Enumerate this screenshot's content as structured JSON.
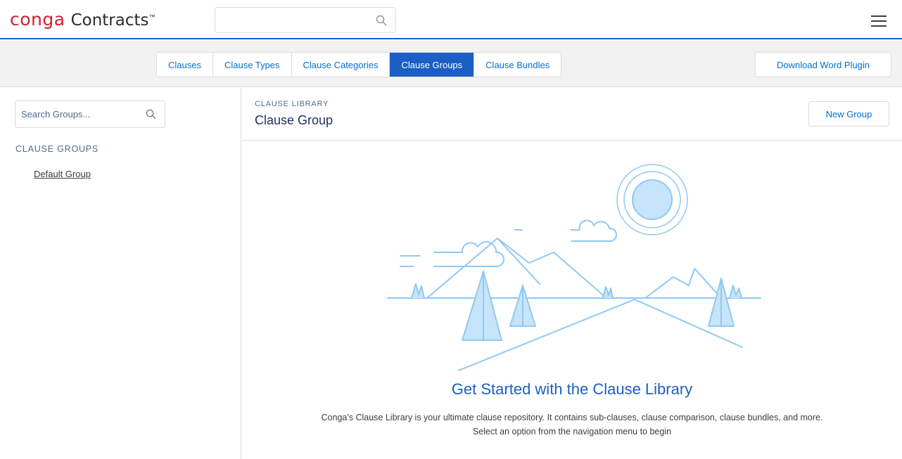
{
  "header": {
    "logo_brand": "conga",
    "logo_product": "Contracts",
    "logo_tm": "™",
    "search_placeholder": "",
    "search_icon": "search-icon",
    "menu_icon": "hamburger-menu-icon"
  },
  "tabs": {
    "items": [
      {
        "label": "Clauses",
        "active": false
      },
      {
        "label": "Clause Types",
        "active": false
      },
      {
        "label": "Clause Categories",
        "active": false
      },
      {
        "label": "Clause Groups",
        "active": true
      },
      {
        "label": "Clause Bundles",
        "active": false
      }
    ],
    "download_label": "Download Word Plugin"
  },
  "sidebar": {
    "search_placeholder": "Search Groups...",
    "heading": "CLAUSE GROUPS",
    "items": [
      {
        "label": "Default Group"
      }
    ]
  },
  "main": {
    "eyebrow": "CLAUSE LIBRARY",
    "title": "Clause Group",
    "new_button_label": "New Group",
    "empty_state": {
      "title": "Get Started with the Clause Library",
      "description_line1": "Conga's Clause Library is your ultimate clause repository. It contains sub-clauses, clause comparison, clause bundles, and more.",
      "description_line2": "Select an option from the navigation menu to begin",
      "illustration": "mountain-landscape-illustration"
    }
  },
  "colors": {
    "brand_red": "#d0202e",
    "accent_blue": "#1b5fc4",
    "link_blue": "#0070d2",
    "illustration_blue": "#8fc9f3"
  }
}
